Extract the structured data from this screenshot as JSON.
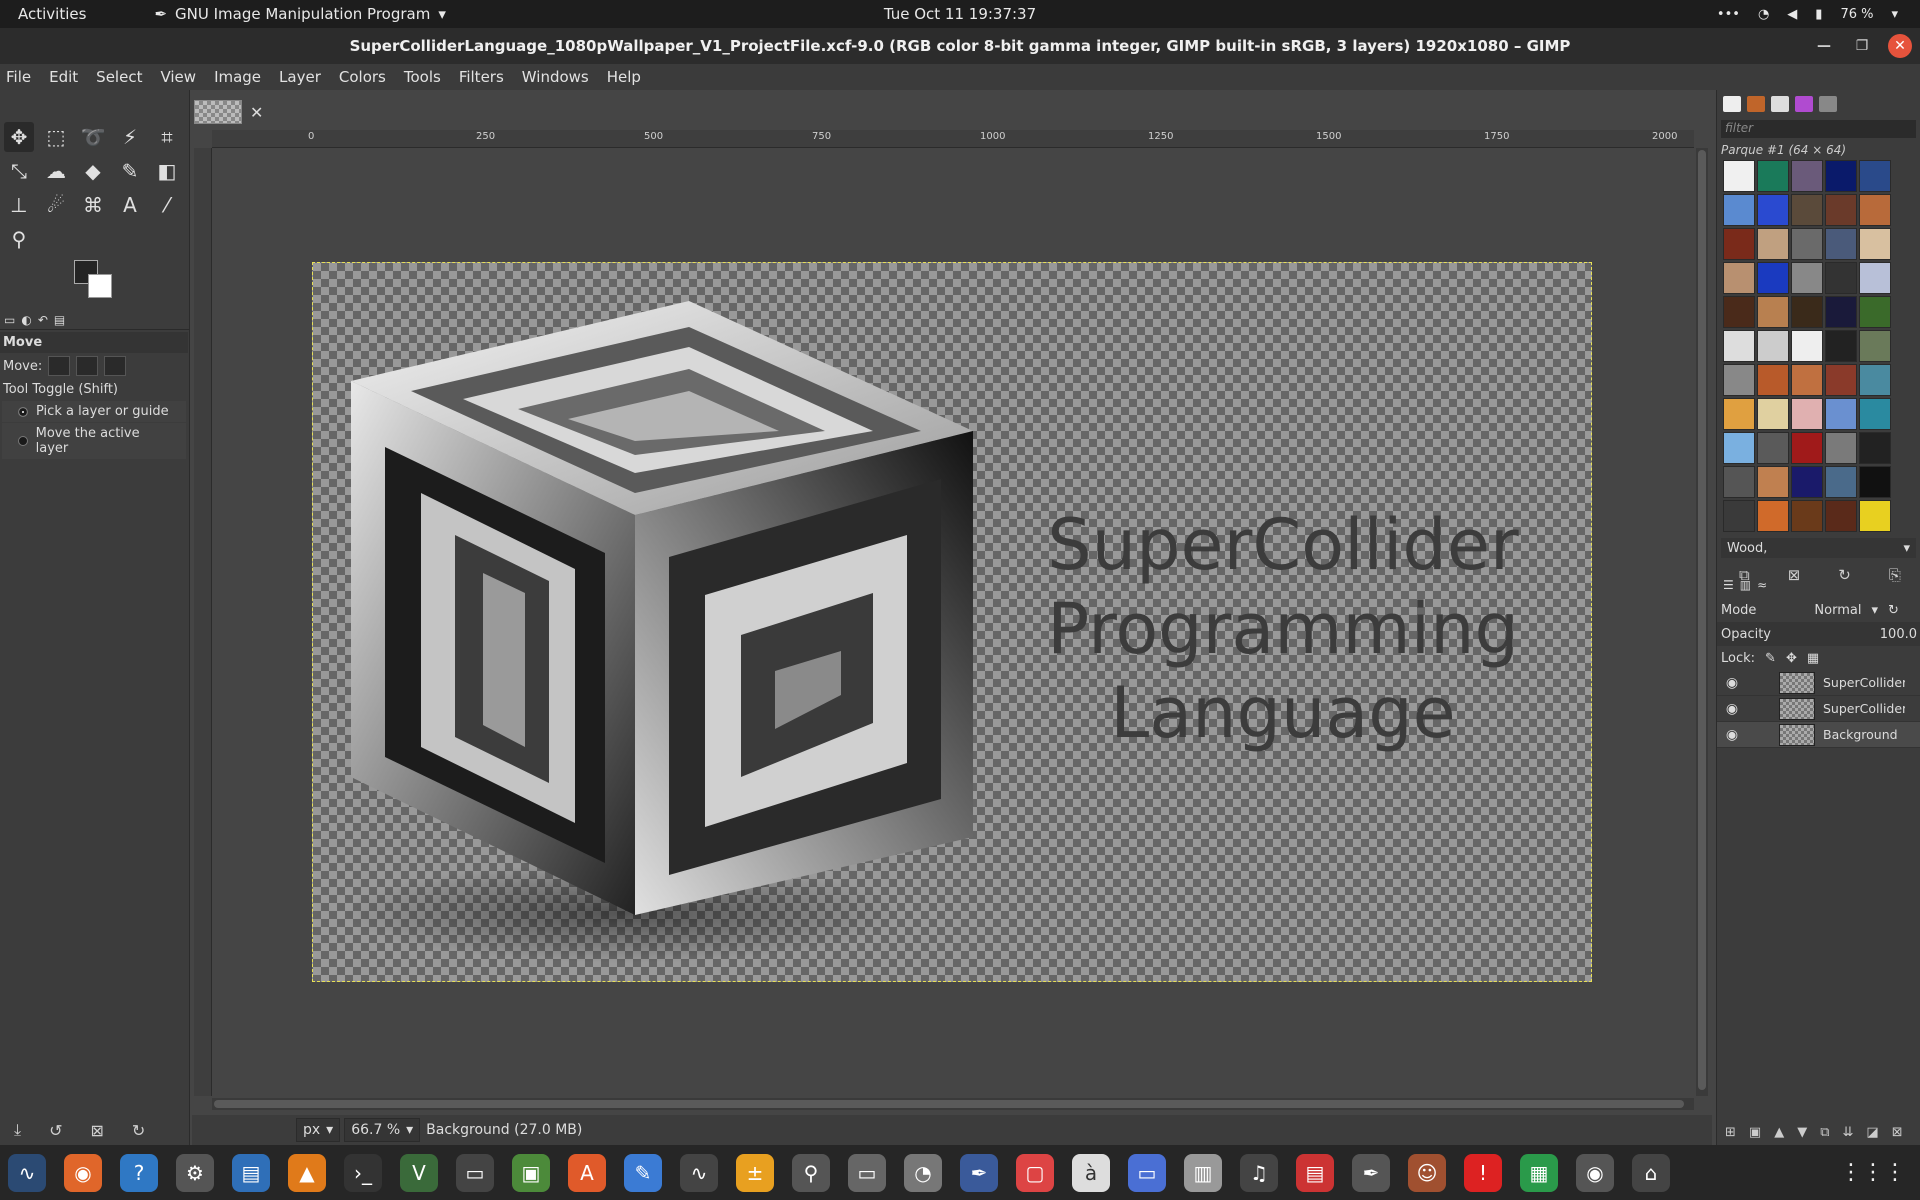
{
  "system": {
    "activities": "Activities",
    "app_name": "GNU Image Manipulation Program",
    "clock": "Tue Oct 11  19:37:37",
    "battery": "76 %"
  },
  "window": {
    "title": "SuperColliderLanguage_1080pWallpaper_V1_ProjectFile.xcf-9.0 (RGB color 8-bit gamma integer, GIMP built-in sRGB, 3 layers) 1920x1080 – GIMP"
  },
  "menu": [
    "File",
    "Edit",
    "Select",
    "View",
    "Image",
    "Layer",
    "Colors",
    "Tools",
    "Filters",
    "Windows",
    "Help"
  ],
  "tool_options": {
    "title": "Move",
    "move_label": "Move:",
    "toggle_label": "Tool Toggle  (Shift)",
    "option1": "Pick a layer or guide",
    "option2": "Move the active layer"
  },
  "rulers": {
    "h_ticks": [
      "0",
      "250",
      "500",
      "750",
      "1000",
      "1250",
      "1500",
      "1750",
      "2000"
    ]
  },
  "canvas": {
    "line1": "SuperCollider",
    "line2": "Programming",
    "line3": "Language"
  },
  "status": {
    "unit": "px",
    "zoom": "66.7 %",
    "info": "Background (27.0 MB)"
  },
  "patterns": {
    "filter_placeholder": "filter",
    "title": "Parque #1 (64 × 64)",
    "selected": "Wood,"
  },
  "layers": {
    "mode_label": "Mode",
    "mode_value": "Normal",
    "opacity_label": "Opacity",
    "opacity_value": "100.0",
    "lock_label": "Lock:",
    "items": [
      {
        "name": "SuperCollider ..."
      },
      {
        "name": "SuperCollider_..."
      },
      {
        "name": "Background"
      }
    ]
  },
  "colors": {
    "accent_close": "#e6533c",
    "selection_border": "#e8e055"
  }
}
